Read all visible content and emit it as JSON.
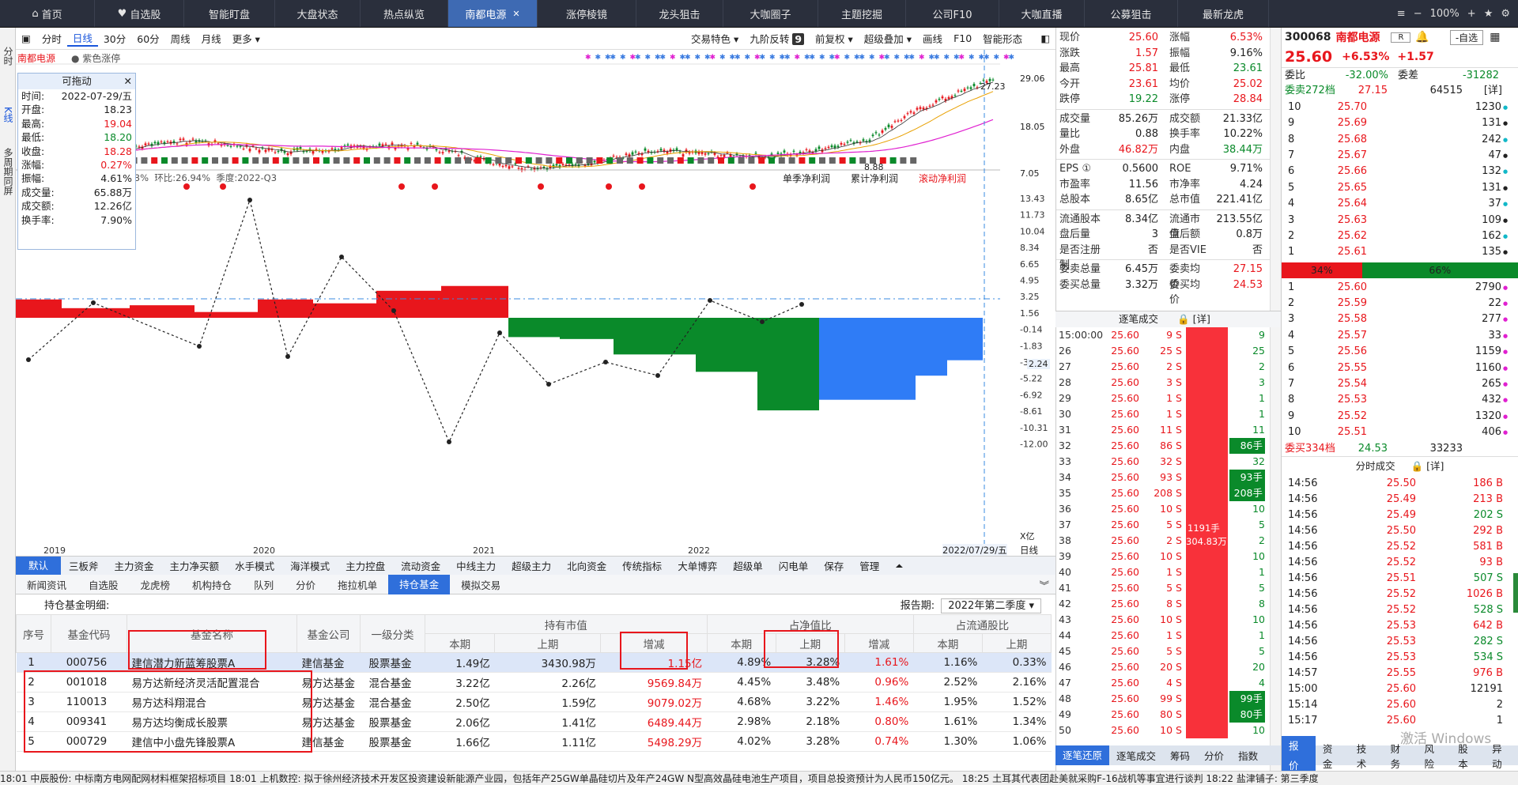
{
  "nav": {
    "tabs": [
      "首页",
      "自选股",
      "智能盯盘",
      "大盘状态",
      "热点纵览",
      "南都电源",
      "涨停棱镜",
      "龙头狙击",
      "大咖圈子",
      "主题挖掘",
      "公司F10",
      "大咖直播",
      "公募狙击",
      "最新龙虎"
    ],
    "active": "南都电源",
    "zoom": "100%"
  },
  "left_strip": [
    "分时",
    "K线",
    "多周期同屏"
  ],
  "toolbar": {
    "left": [
      "分时",
      "日线",
      "30分",
      "60分",
      "周线",
      "月线",
      "更多"
    ],
    "active": "日线",
    "right": [
      "交易特色",
      "九阶反转",
      "9",
      "前复权",
      "超级叠加",
      "画线",
      "F10",
      "智能形态"
    ]
  },
  "chart": {
    "stock_name": "南都电源",
    "sub": "紫色涨停",
    "price_labels": [
      "29.06",
      "18.05",
      "7.05"
    ],
    "hi_mark": "27.23",
    "lo_mark": "8.88",
    "bottom_header": {
      "pct": "-22.23%",
      "ring": "环比:26.94%",
      "season": "季度:2022-Q3"
    },
    "profit_tabs": [
      "单季净利润",
      "累计净利润",
      "滚动净利润"
    ],
    "y_ticks": [
      "13.43",
      "11.73",
      "10.04",
      "8.34",
      "6.65",
      "4.95",
      "3.25",
      "1.56",
      "-0.14",
      "-1.83",
      "-3.53",
      "-5.22",
      "-6.92",
      "-8.61",
      "-10.31",
      "-12.00"
    ],
    "y_unit": "X亿",
    "current_label": "2.24",
    "x_labels": [
      "2019",
      "2020",
      "2021",
      "2022"
    ],
    "date_label": "2022/07/29/五",
    "period_label": "日线"
  },
  "legend": {
    "title": "可拖动",
    "rows": [
      {
        "k": "时间:",
        "v": "2022-07-29/五"
      },
      {
        "k": "开盘:",
        "v": "18.23"
      },
      {
        "k": "最高:",
        "v": "19.04"
      },
      {
        "k": "最低:",
        "v": "18.20"
      },
      {
        "k": "收盘:",
        "v": "18.28"
      },
      {
        "k": "涨幅:",
        "v": "0.27%"
      },
      {
        "k": "振幅:",
        "v": "4.61%"
      },
      {
        "k": "成交量:",
        "v": "65.88万"
      },
      {
        "k": "成交额:",
        "v": "12.26亿"
      },
      {
        "k": "换手率:",
        "v": "7.90%"
      }
    ]
  },
  "tabs1": [
    "默认",
    "三板斧",
    "主力资金",
    "主力净买额",
    "水手模式",
    "海洋模式",
    "主力控盘",
    "流动资金",
    "中线主力",
    "超级主力",
    "北向资金",
    "传统指标",
    "大单博弈",
    "超级单",
    "闪电单",
    "保存",
    "管理"
  ],
  "tabs2": [
    "新闻资讯",
    "自选股",
    "龙虎榜",
    "机构持仓",
    "队列",
    "分价",
    "拖拉机单",
    "持仓基金",
    "模拟交易"
  ],
  "fund": {
    "title": "持仓基金明细:",
    "period_label": "报告期:",
    "period": "2022年第二季度",
    "group_headers": [
      "持有市值",
      "占净值比",
      "占流通股比"
    ],
    "headers": [
      "序号",
      "基金代码",
      "基金名称",
      "基金公司",
      "一级分类",
      "本期",
      "上期",
      "增减",
      "本期",
      "上期",
      "增减",
      "本期",
      "上期"
    ],
    "rows": [
      [
        "1",
        "000756",
        "建信潜力新蓝筹股票A",
        "建信基金",
        "股票基金",
        "1.49亿",
        "3430.98万",
        "1.15亿",
        "4.89%",
        "3.28%",
        "1.61%",
        "1.16%",
        "0.33%"
      ],
      [
        "2",
        "001018",
        "易方达新经济灵活配置混合",
        "易方达基金",
        "混合基金",
        "3.22亿",
        "2.26亿",
        "9569.84万",
        "4.45%",
        "3.48%",
        "0.96%",
        "2.52%",
        "2.16%"
      ],
      [
        "3",
        "110013",
        "易方达科翔混合",
        "易方达基金",
        "混合基金",
        "2.50亿",
        "1.59亿",
        "9079.02万",
        "4.68%",
        "3.22%",
        "1.46%",
        "1.95%",
        "1.52%"
      ],
      [
        "4",
        "009341",
        "易方达均衡成长股票",
        "易方达基金",
        "股票基金",
        "2.06亿",
        "1.41亿",
        "6489.44万",
        "2.98%",
        "2.18%",
        "0.80%",
        "1.61%",
        "1.34%"
      ],
      [
        "5",
        "000729",
        "建信中小盘先锋股票A",
        "建信基金",
        "股票基金",
        "1.66亿",
        "1.11亿",
        "5498.29万",
        "4.02%",
        "3.28%",
        "0.74%",
        "1.30%",
        "1.06%"
      ]
    ]
  },
  "quote": {
    "rows": [
      [
        "现价",
        "25.60",
        "涨幅",
        "6.53%"
      ],
      [
        "涨跌",
        "1.57",
        "振幅",
        "9.16%"
      ],
      [
        "最高",
        "25.81",
        "最低",
        "23.61"
      ],
      [
        "今开",
        "23.61",
        "均价",
        "25.02"
      ],
      [
        "跌停",
        "19.22",
        "涨停",
        "28.84"
      ],
      [
        "成交量",
        "85.26万",
        "成交额",
        "21.33亿"
      ],
      [
        "量比",
        "0.88",
        "换手率",
        "10.22%"
      ],
      [
        "外盘",
        "46.82万",
        "内盘",
        "38.44万"
      ],
      [
        "EPS ①",
        "0.5600",
        "ROE",
        "9.71%"
      ],
      [
        "市盈率",
        "11.56",
        "市净率",
        "4.24"
      ],
      [
        "总股本",
        "8.65亿",
        "总市值",
        "221.41亿"
      ],
      [
        "流通股本",
        "8.34亿",
        "流通市值",
        "213.55亿"
      ],
      [
        "盘后量",
        "3",
        "盘后额",
        "0.8万"
      ],
      [
        "是否注册制",
        "否",
        "是否VIE",
        "否"
      ],
      [
        "委卖总量",
        "6.45万",
        "委卖均价",
        "27.15"
      ],
      [
        "委买总量",
        "3.32万",
        "委买均价",
        "24.53"
      ]
    ]
  },
  "ticks": {
    "title": "逐笔成交",
    "detail": "[详]",
    "rows": [
      [
        "15:00:00",
        "25.60",
        "9 S",
        "9"
      ],
      [
        "26",
        "25.60",
        "25 S",
        "25"
      ],
      [
        "27",
        "25.60",
        "2 S",
        "2"
      ],
      [
        "28",
        "25.60",
        "3 S",
        "3"
      ],
      [
        "29",
        "25.60",
        "1 S",
        "1"
      ],
      [
        "30",
        "25.60",
        "1 S",
        "1"
      ],
      [
        "31",
        "25.60",
        "11 S",
        "11"
      ],
      [
        "32",
        "25.60",
        "86 S",
        "86手"
      ],
      [
        "33",
        "25.60",
        "32 S",
        "32"
      ],
      [
        "34",
        "25.60",
        "93 S",
        "93手"
      ],
      [
        "35",
        "25.60",
        "208 S",
        "208手"
      ],
      [
        "36",
        "25.60",
        "10 S",
        "10"
      ],
      [
        "37",
        "25.60",
        "5 S",
        "5"
      ],
      [
        "38",
        "25.60",
        "2 S",
        "2"
      ],
      [
        "39",
        "25.60",
        "10 S",
        "10"
      ],
      [
        "40",
        "25.60",
        "1 S",
        "1"
      ],
      [
        "41",
        "25.60",
        "5 S",
        "5"
      ],
      [
        "42",
        "25.60",
        "8 S",
        "8"
      ],
      [
        "43",
        "25.60",
        "10 S",
        "10"
      ],
      [
        "44",
        "25.60",
        "1 S",
        "1"
      ],
      [
        "45",
        "25.60",
        "5 S",
        "5"
      ],
      [
        "46",
        "25.60",
        "20 S",
        "20"
      ],
      [
        "47",
        "25.60",
        "4 S",
        "4"
      ],
      [
        "48",
        "25.60",
        "99 S",
        "99手"
      ],
      [
        "49",
        "25.60",
        "80 S",
        "80手"
      ],
      [
        "50",
        "25.60",
        "10 S",
        "10"
      ]
    ],
    "bar_label1": "1191手",
    "bar_label2": "304.83万"
  },
  "right_tabs": [
    "逐笔还原",
    "逐笔成交",
    "筹码",
    "分价",
    "指数"
  ],
  "book": {
    "code": "300068",
    "name": "南都电源",
    "btn": "-自选",
    "price": "25.60",
    "pct": "+6.53%",
    "chg": "+1.57",
    "weibi_k": "委比",
    "weibi": "-32.00%",
    "weicha_k": "委差",
    "weicha": "-31282",
    "sell_head": [
      "委卖272档",
      "27.15",
      "64515",
      "[详]"
    ],
    "sells": [
      [
        "10",
        "25.70",
        "1230"
      ],
      [
        "9",
        "25.69",
        "131"
      ],
      [
        "8",
        "25.68",
        "242"
      ],
      [
        "7",
        "25.67",
        "47"
      ],
      [
        "6",
        "25.66",
        "132"
      ],
      [
        "5",
        "25.65",
        "131"
      ],
      [
        "4",
        "25.64",
        "37"
      ],
      [
        "3",
        "25.63",
        "109"
      ],
      [
        "2",
        "25.62",
        "162"
      ],
      [
        "1",
        "25.61",
        "135"
      ]
    ],
    "split": [
      "34%",
      "66%"
    ],
    "buys": [
      [
        "1",
        "25.60",
        "2790"
      ],
      [
        "2",
        "25.59",
        "22"
      ],
      [
        "3",
        "25.58",
        "277"
      ],
      [
        "4",
        "25.57",
        "33"
      ],
      [
        "5",
        "25.56",
        "1159"
      ],
      [
        "6",
        "25.55",
        "1160"
      ],
      [
        "7",
        "25.54",
        "265"
      ],
      [
        "8",
        "25.53",
        "432"
      ],
      [
        "9",
        "25.52",
        "1320"
      ],
      [
        "10",
        "25.51",
        "406"
      ]
    ],
    "buy_head": [
      "委买334档",
      "24.53",
      "33233"
    ],
    "minute_title": "分时成交",
    "minute_detail": "[详]",
    "minutes": [
      [
        "14:56",
        "25.50",
        "186 B"
      ],
      [
        "14:56",
        "25.49",
        "213 B"
      ],
      [
        "14:56",
        "25.49",
        "202 S"
      ],
      [
        "14:56",
        "25.50",
        "292 B"
      ],
      [
        "14:56",
        "25.52",
        "581 B"
      ],
      [
        "14:56",
        "25.52",
        "93 B"
      ],
      [
        "14:56",
        "25.51",
        "507 S"
      ],
      [
        "14:56",
        "25.52",
        "1026 B"
      ],
      [
        "14:56",
        "25.52",
        "528 S"
      ],
      [
        "14:56",
        "25.53",
        "642 B"
      ],
      [
        "14:56",
        "25.53",
        "282 S"
      ],
      [
        "14:56",
        "25.53",
        "534 S"
      ],
      [
        "14:57",
        "25.55",
        "976 B"
      ],
      [
        "15:00",
        "25.60",
        "12191"
      ],
      [
        "15:14",
        "25.60",
        "2"
      ],
      [
        "15:17",
        "25.60",
        "1"
      ]
    ],
    "tabs": [
      "报价",
      "资金",
      "技术",
      "财务",
      "风险",
      "股本",
      "异动"
    ],
    "watermark": "激活 Windows"
  },
  "status": {
    "text": "18:01 中辰股份: 中标南方电网配网材料框架招标项目     18:01 上机数控: 拟于徐州经济技术开发区投资建设新能源产业园，包括年产25GW单晶硅切片及年产24GW N型高效晶硅电池生产项目，项目总投资预计为人民币150亿元。     18:25 土耳其代表团赴美就采购F-16战机等事宜进行谈判     18:22 盐津铺子: 第三季度"
  },
  "colors": {
    "up": "#e8161c",
    "down": "#0a8a2a",
    "accent": "#2f6fdb",
    "nav_bg": "#2a2f3c"
  }
}
